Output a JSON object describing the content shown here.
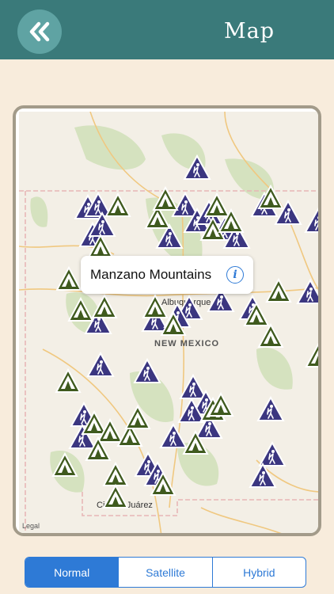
{
  "header": {
    "title": "Map",
    "back_icon": "double-chevron-left-icon",
    "background_color": "#3a7a7a",
    "back_button_color": "#5fa3a3"
  },
  "map": {
    "labels": {
      "state": "NEW MEXICO",
      "city_albuquerque": "Albuquerque",
      "city_juarez": "Ciudad Juárez",
      "legal": "Legal"
    },
    "callout": {
      "title": "Manzano Mountains",
      "info_icon": "info-icon"
    },
    "marker_types": {
      "campground": {
        "icon": "tent-icon",
        "color": "#3f5a1e"
      },
      "hiking": {
        "icon": "hiker-icon",
        "color": "#3b3680"
      }
    }
  },
  "segmented_control": {
    "options": [
      "Normal",
      "Satellite",
      "Hybrid"
    ],
    "selected": "Normal",
    "color": "#2e7ad6"
  }
}
